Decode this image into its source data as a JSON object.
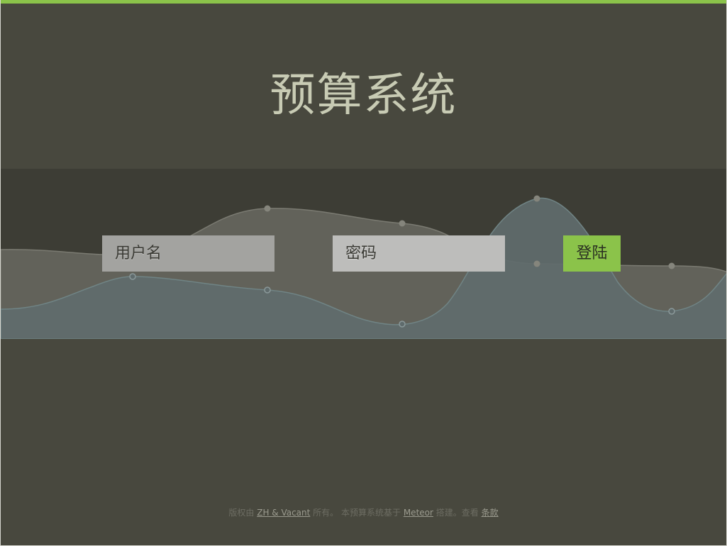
{
  "app": {
    "title": "预算系统"
  },
  "login": {
    "username_placeholder": "用户名",
    "password_placeholder": "密码",
    "submit_label": "登陆"
  },
  "footer": {
    "text_1": "版权由",
    "link_owner": "ZH & Vacant",
    "text_2": "所有。 本预算系统基于",
    "link_framework": "Meteor",
    "text_3": "搭建。查看",
    "link_terms": "条款"
  },
  "colors": {
    "background": "#48483e",
    "band": "#3d3d35",
    "accent": "#8bc34a",
    "title": "#c8cbb4",
    "wave_gray": "#62625a",
    "wave_slate": "#5f6b6c"
  }
}
